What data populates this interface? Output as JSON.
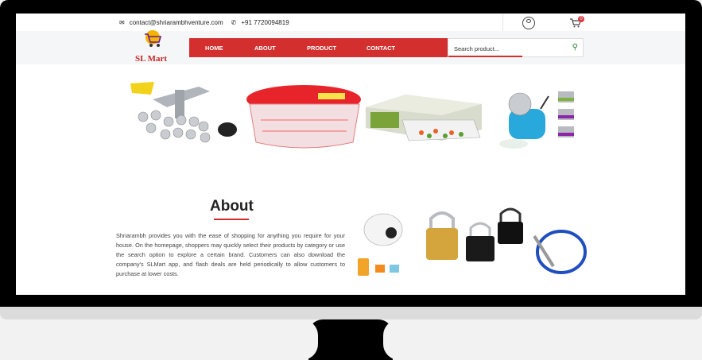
{
  "topbar": {
    "email": "contact@shriarambhventure.com",
    "phone": "+91 7720094819",
    "cart_count": "0",
    "icons": [
      "envelope-icon",
      "phone-icon",
      "user-icon",
      "cart-icon"
    ]
  },
  "logo": {
    "text": "SL Mart"
  },
  "nav": {
    "items": [
      {
        "label": "HOME"
      },
      {
        "label": "ABOUT"
      },
      {
        "label": "PRODUCT"
      },
      {
        "label": "CONTACT"
      }
    ]
  },
  "search": {
    "placeholder": "Search product..."
  },
  "banner": {
    "items": [
      "kitchen-press-set",
      "red-lid-storage-container",
      "vegetable-slicer-box",
      "blue-rotary-grater"
    ]
  },
  "about": {
    "title": "About",
    "body": "Shriarambh provides you with the ease of shopping for anything you require for your house. On the homepage, shoppers may quickly select their products by category or use the search option to explore a certain brand. Customers can also download the company's SLMart app, and flash deals are held periodically to allow customers to purchase at lower costs.",
    "image": "security-products-collage"
  },
  "colors": {
    "accent": "#d32f2f",
    "search_icon": "#2e7d32",
    "bezel": "#000000"
  }
}
